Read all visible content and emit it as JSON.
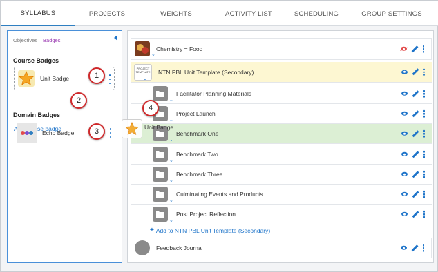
{
  "tabs": [
    {
      "label": "SYLLABUS",
      "active": true
    },
    {
      "label": "PROJECTS"
    },
    {
      "label": "WEIGHTS"
    },
    {
      "label": "ACTIVITY LIST"
    },
    {
      "label": "SCHEDULING"
    },
    {
      "label": "GROUP SETTINGS"
    }
  ],
  "left_panel": {
    "subtabs": [
      "Objectives",
      "Badges"
    ],
    "active_subtab": "Badges",
    "course_badges_title": "Course Badges",
    "course_badge_label": "Unit Badge",
    "add_course_badge": "Add course badge",
    "domain_badges_title": "Domain Badges",
    "domain_badge_label": "Echo Badge"
  },
  "callouts": [
    "1",
    "2",
    "3",
    "4"
  ],
  "drag": {
    "label": "Unit Badge"
  },
  "projects": {
    "top": {
      "name": "Chemistry = Food",
      "visible": false
    },
    "template": {
      "name": "NTN PBL Unit Template (Secondary)",
      "thumb_text": "PROJECT TEMPLATE"
    },
    "items": [
      {
        "name": "Facilitator Planning Materials"
      },
      {
        "name": "Project Launch"
      },
      {
        "name": "Benchmark One",
        "highlight": true
      },
      {
        "name": "Benchmark Two"
      },
      {
        "name": "Benchmark Three"
      },
      {
        "name": "Culminating Events and Products"
      },
      {
        "name": "Post Project Reflection"
      }
    ],
    "add_label": "Add to NTN PBL Unit Template (Secondary)",
    "bottom": {
      "name": "Feedback Journal"
    }
  },
  "colors": {
    "accent": "#1e74c9",
    "badges_tab": "#9b3bb2",
    "template_row": "#fdf7d2",
    "highlight_row": "#dcefd4",
    "callout_border": "#d0282a"
  },
  "icons": [
    "star-icon",
    "folder-icon",
    "eye-icon",
    "eye-hidden-icon",
    "pencil-icon",
    "kebab-icon",
    "plus-icon",
    "caret-down-icon"
  ]
}
